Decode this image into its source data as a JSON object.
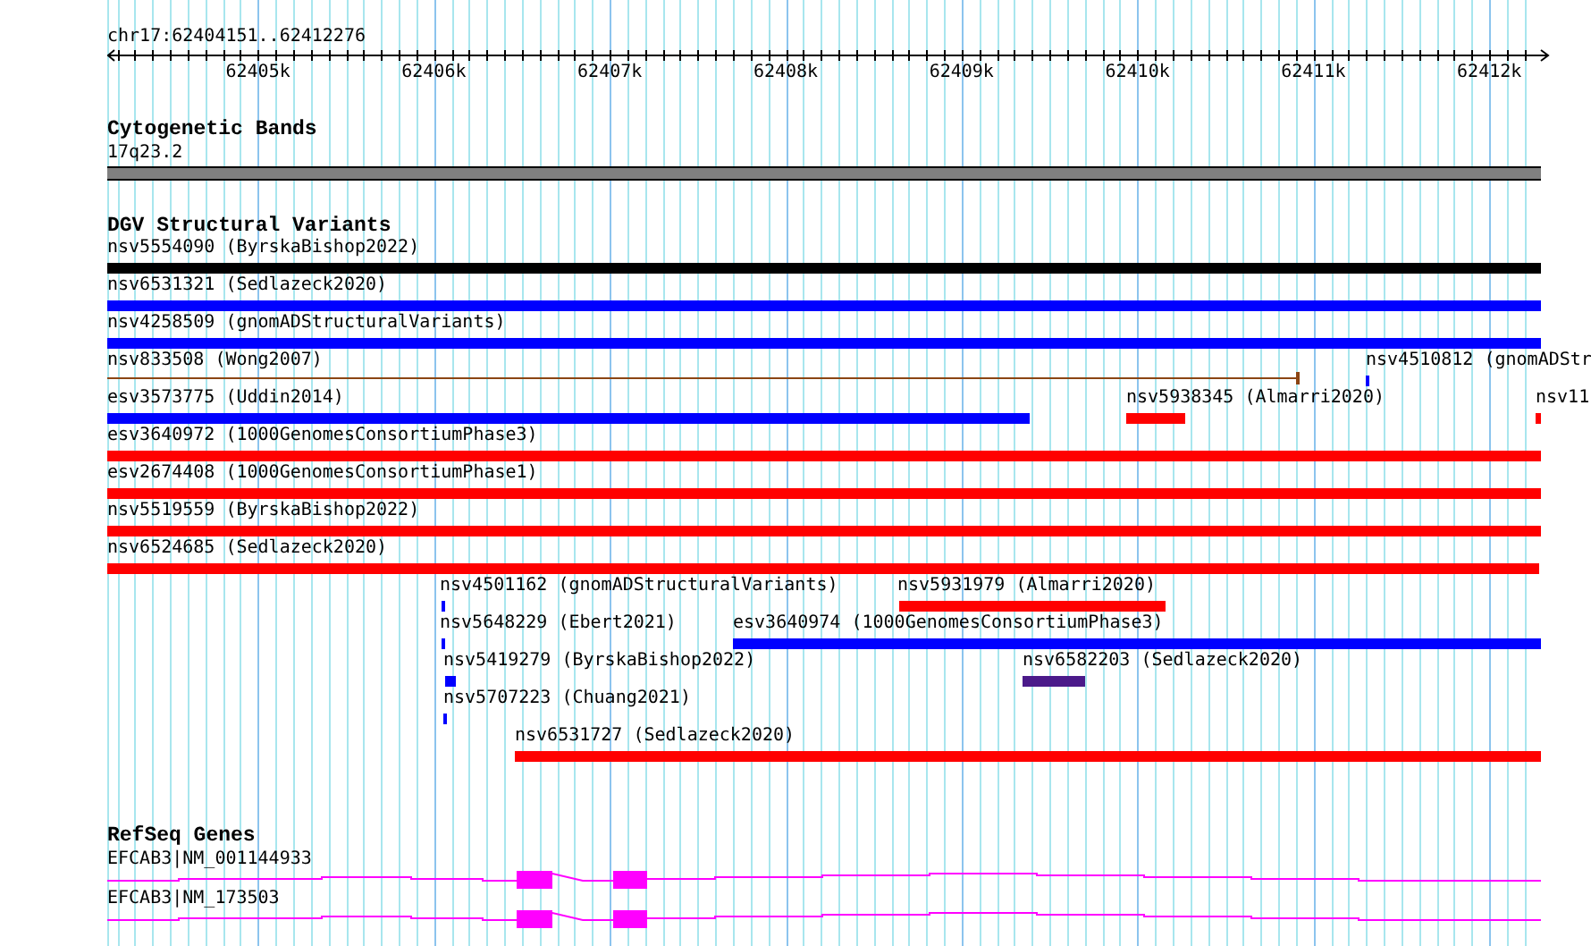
{
  "ruler": {
    "location": "chr17:62404151..62412276",
    "ticks": [
      "62405k",
      "62406k",
      "62407k",
      "62408k",
      "62409k",
      "62410k",
      "62411k",
      "62412k"
    ]
  },
  "tracks": [
    {
      "kind": "bands",
      "title": "Cytogenetic Bands",
      "features": [
        {
          "label": "17q23.2"
        }
      ]
    },
    {
      "kind": "variants",
      "title": "DGV Structural Variants",
      "features": [
        {
          "label": "nsv5554090 (ByrskaBishop2022)",
          "color": "#000000"
        },
        {
          "label": "nsv6531321 (Sedlazeck2020)",
          "color": "#0000ff"
        },
        {
          "label": "nsv4258509 (gnomADStructuralVariants)",
          "color": "#0000ff"
        },
        {
          "label": "nsv833508 (Wong2007)",
          "color": "#8b4513"
        },
        {
          "label": "nsv4510812 (gnomADStr",
          "color": "#0000ff"
        },
        {
          "label": "esv3573775 (Uddin2014)",
          "color": "#0000ff"
        },
        {
          "label": "nsv5938345 (Almarri2020)",
          "color": "#ff0000"
        },
        {
          "label": "nsv11",
          "color": "#ff0000"
        },
        {
          "label": "esv3640972 (1000GenomesConsortiumPhase3)",
          "color": "#ff0000"
        },
        {
          "label": "esv2674408 (1000GenomesConsortiumPhase1)",
          "color": "#ff0000"
        },
        {
          "label": "nsv5519559 (ByrskaBishop2022)",
          "color": "#ff0000"
        },
        {
          "label": "nsv6524685 (Sedlazeck2020)",
          "color": "#ff0000"
        },
        {
          "label": "nsv4501162 (gnomADStructuralVariants)",
          "color": "#0000ff"
        },
        {
          "label": "nsv5931979 (Almarri2020)",
          "color": "#ff0000"
        },
        {
          "label": "nsv5648229 (Ebert2021)",
          "color": "#0000ff"
        },
        {
          "label": "esv3640974 (1000GenomesConsortiumPhase3)",
          "color": "#0000ff"
        },
        {
          "label": "nsv5419279 (ByrskaBishop2022)",
          "color": "#0000ff"
        },
        {
          "label": "nsv6582203 (Sedlazeck2020)",
          "color": "#4b1a8a"
        },
        {
          "label": "nsv5707223 (Chuang2021)",
          "color": "#0000ff"
        },
        {
          "label": "nsv6531727 (Sedlazeck2020)",
          "color": "#ff0000"
        }
      ]
    },
    {
      "kind": "genes",
      "title": "RefSeq Genes",
      "features": [
        {
          "label": "EFCAB3|NM_001144933"
        },
        {
          "label": "EFCAB3|NM_173503"
        }
      ]
    }
  ]
}
